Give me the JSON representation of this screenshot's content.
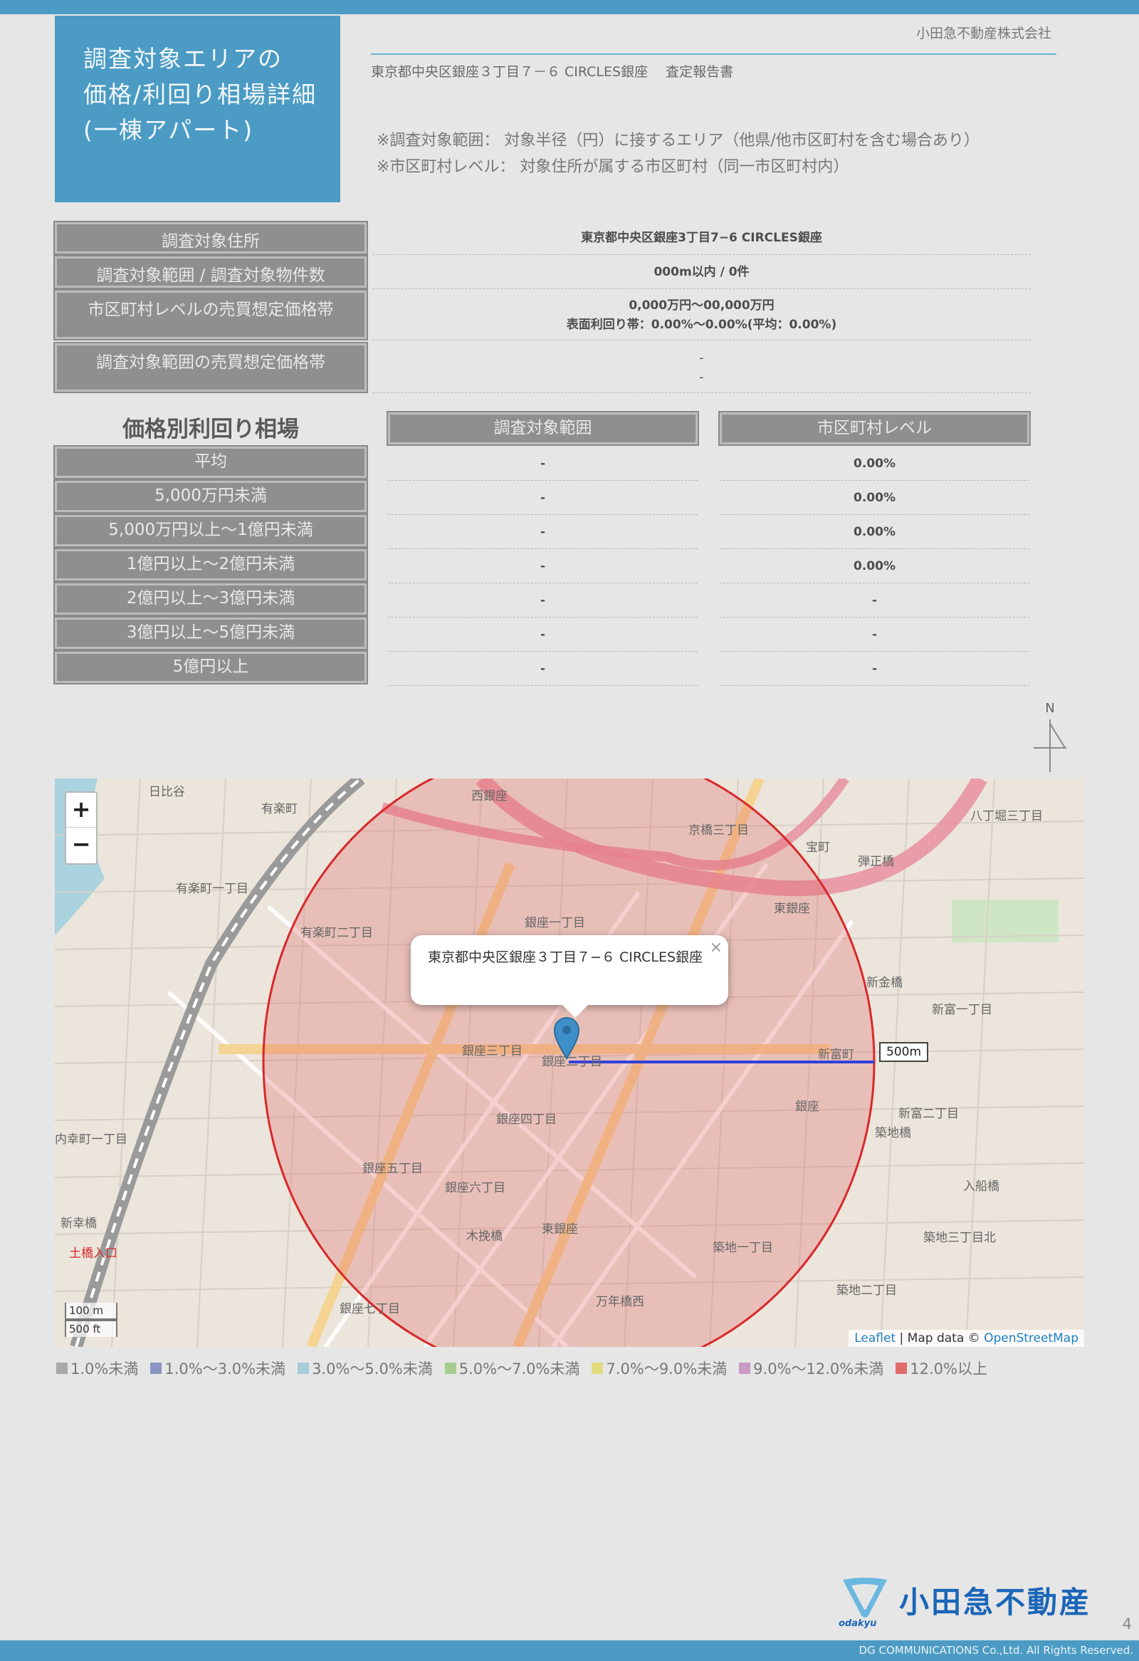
{
  "header": {
    "title_lines": [
      "調査対象エリアの",
      "価格/利回り相場詳細",
      "(一棟アパート)"
    ],
    "company": "小田急不動産株式会社",
    "report_subtitle": "東京都中央区銀座３丁目７－６ CIRCLES銀座　 査定報告書",
    "note1": "※調査対象範囲： 対象半径（円）に接するエリア（他県/他市区町村を含む場合あり）",
    "note2": "※市区町村レベル： 対象住所が属する市区町村（同一市区町村内）"
  },
  "summary": {
    "rows": [
      {
        "label": "調査対象住所",
        "value_lines": [
          "東京都中央区銀座3丁目7−6 CIRCLES銀座"
        ]
      },
      {
        "label": "調査対象範囲 / 調査対象物件数",
        "value_lines": [
          "000m以内 / 0件"
        ]
      },
      {
        "label": "市区町村レベルの売買想定価格帯",
        "value_lines": [
          "0,000万円～00,000万円",
          "表面利回り帯：0.00%～0.00%(平均：0.00%)"
        ]
      },
      {
        "label": "調査対象範囲の売買想定価格帯",
        "value_lines": [
          "-",
          "-"
        ]
      }
    ]
  },
  "yield_table": {
    "heading": "価格別利回り相場",
    "col_headers": [
      "調査対象範囲",
      "市区町村レベル"
    ],
    "rows": [
      {
        "label": "平均",
        "values": [
          "-",
          "0.00%"
        ]
      },
      {
        "label": "5,000万円未満",
        "values": [
          "-",
          "0.00%"
        ]
      },
      {
        "label": "5,000万円以上～1億円未満",
        "values": [
          "-",
          "0.00%"
        ]
      },
      {
        "label": "1億円以上～2億円未満",
        "values": [
          "-",
          "0.00%"
        ]
      },
      {
        "label": "2億円以上～3億円未満",
        "values": [
          "-",
          "-"
        ]
      },
      {
        "label": "3億円以上～5億円未満",
        "values": [
          "-",
          "-"
        ]
      },
      {
        "label": "5億円以上",
        "values": [
          "-",
          "-"
        ]
      }
    ]
  },
  "north_label": "N",
  "map": {
    "zoom_in": "+",
    "zoom_out": "−",
    "popup_text": "東京都中央区銀座３丁目７−６ CIRCLES銀座",
    "popup_close": "×",
    "radius_label": "500m",
    "scale_metric": "100 m",
    "scale_imperial": "500 ft",
    "attribution_leaflet": "Leaflet",
    "attribution_text": " | Map data © ",
    "attribution_osm": "OpenStreetMap",
    "place_labels": [
      "日比谷",
      "有楽町",
      "西銀座",
      "京橋三丁目",
      "宝町",
      "八丁堀三丁目",
      "弾正橋",
      "銀座一丁目",
      "東銀座",
      "有楽町二丁目",
      "有楽町一丁目",
      "新金橋",
      "新富一丁目",
      "新富町",
      "銀座三丁目",
      "銀座二丁目",
      "銀座",
      "銀座四丁目",
      "新富二丁目",
      "築地橋",
      "銀座五丁目",
      "東銀座",
      "築地一丁目",
      "木挽橋",
      "銀座六丁目",
      "銀座七丁目",
      "築地二丁目",
      "万年橋西",
      "内幸町一丁目",
      "新幸橋",
      "土橋入口",
      "入船橋",
      "築地三丁目北"
    ],
    "marker_color": "#3f8fc8",
    "circle_color": "#d8282b"
  },
  "legend": [
    {
      "label": "1.0%未満",
      "color": "#a9a9a9"
    },
    {
      "label": "1.0%～3.0%未満",
      "color": "#8c96c4"
    },
    {
      "label": "3.0%～5.0%未満",
      "color": "#a8cbd8"
    },
    {
      "label": "5.0%～7.0%未満",
      "color": "#a7cd8e"
    },
    {
      "label": "7.0%～9.0%未満",
      "color": "#e0dc7c"
    },
    {
      "label": "9.0%～12.0%未満",
      "color": "#c99ac6"
    },
    {
      "label": "12.0%以上",
      "color": "#e06b6b"
    }
  ],
  "footer": {
    "logo_text": "小田急不動産",
    "logo_sub": "odakyu",
    "page_number": "4",
    "copyright": "DG COMMUNICATIONS Co.,Ltd. All Rights Reserved."
  }
}
